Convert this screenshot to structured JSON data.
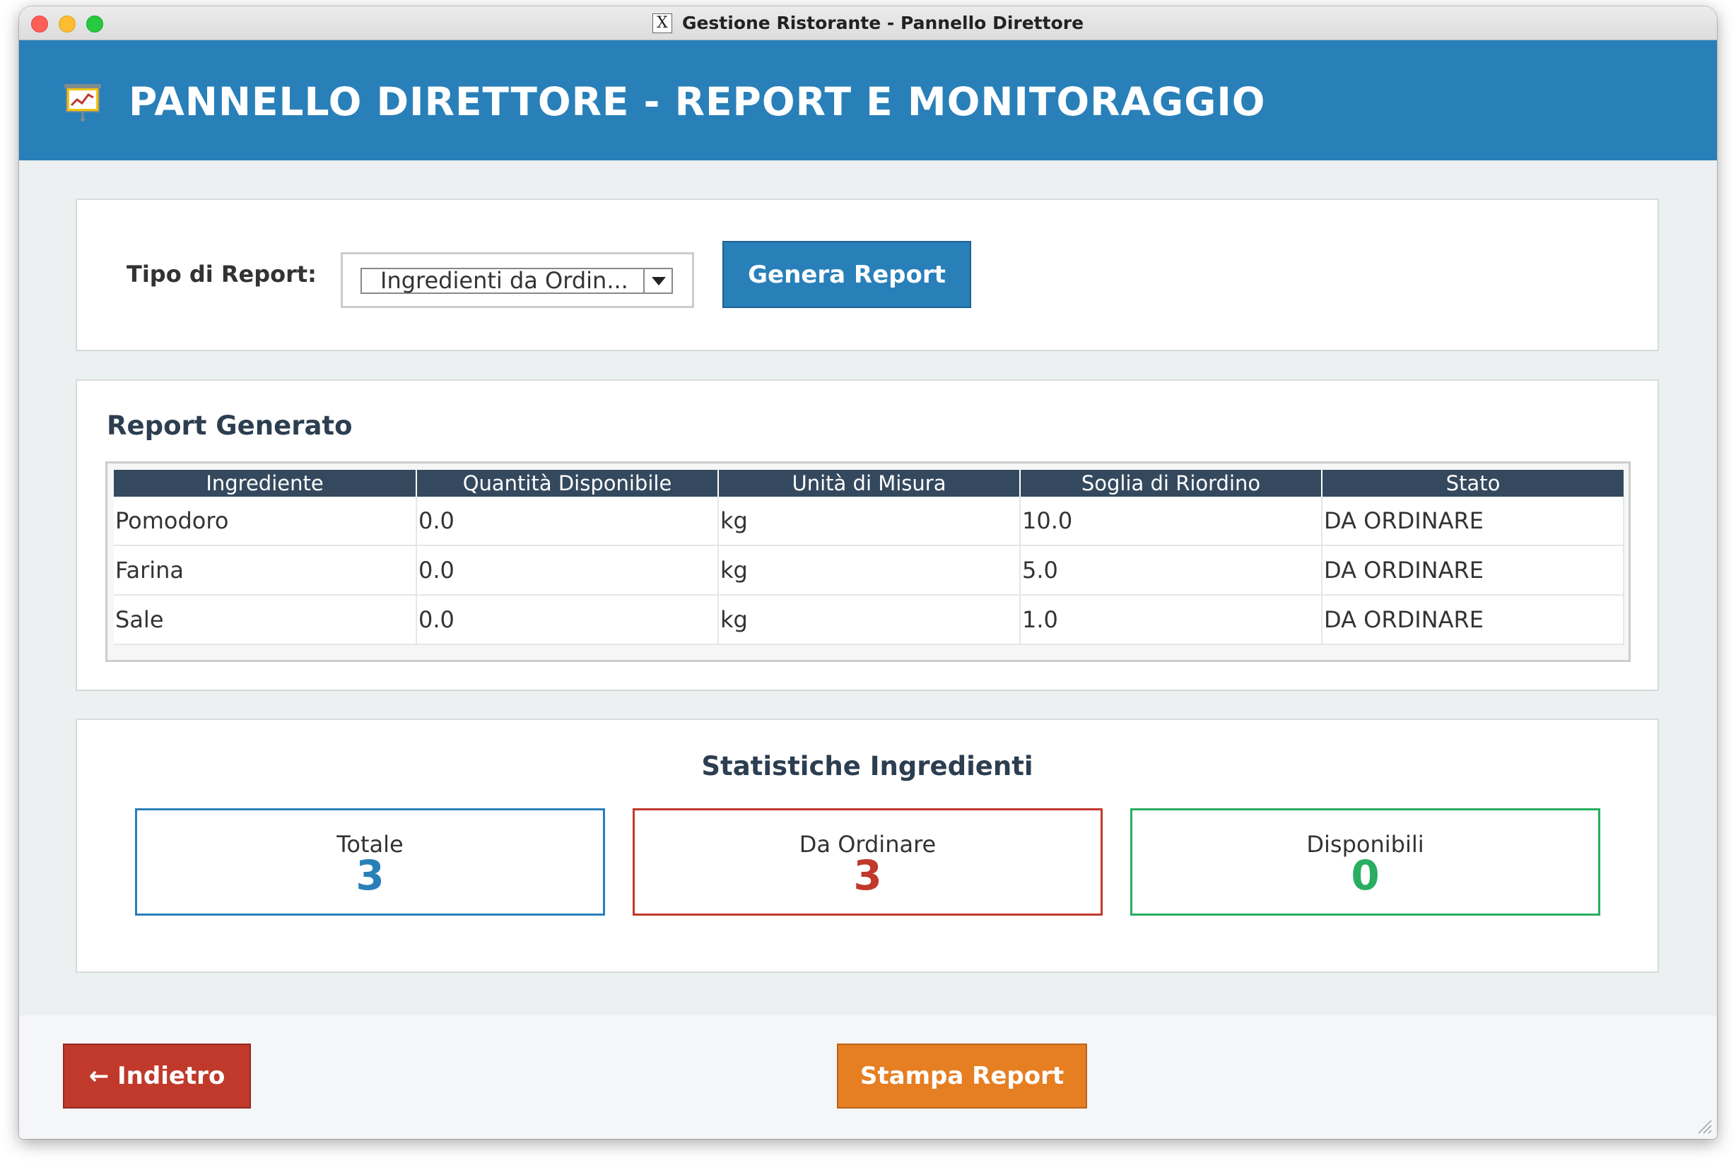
{
  "window": {
    "title": "Gestione Ristorante - Pannello Direttore"
  },
  "header": {
    "title": "PANNELLO DIRETTORE - REPORT E MONITORAGGIO",
    "icon": "presentation-chart-icon"
  },
  "controls": {
    "report_type_label": "Tipo di Report:",
    "report_type_selected": "Ingredienti da Ordin...",
    "generate_button": "Genera Report"
  },
  "report": {
    "title": "Report Generato",
    "columns": [
      "Ingrediente",
      "Quantità Disponibile",
      "Unità di Misura",
      "Soglia di Riordino",
      "Stato"
    ],
    "rows": [
      [
        "Pomodoro",
        "0.0",
        "kg",
        "10.0",
        "DA ORDINARE"
      ],
      [
        "Farina",
        "0.0",
        "kg",
        "5.0",
        "DA ORDINARE"
      ],
      [
        "Sale",
        "0.0",
        "kg",
        "1.0",
        "DA ORDINARE"
      ]
    ]
  },
  "stats": {
    "title": "Statistiche Ingredienti",
    "cards": [
      {
        "label": "Totale",
        "value": "3",
        "color": "#2980b9"
      },
      {
        "label": "Da Ordinare",
        "value": "3",
        "color": "#c0392b"
      },
      {
        "label": "Disponibili",
        "value": "0",
        "color": "#27ae60"
      }
    ]
  },
  "footer": {
    "back_button": "← Indietro",
    "print_button": "Stampa Report"
  },
  "colors": {
    "header_bg": "#2980b9",
    "table_header_bg": "#34495e",
    "back_button_bg": "#c0392b",
    "print_button_bg": "#e67e22"
  }
}
